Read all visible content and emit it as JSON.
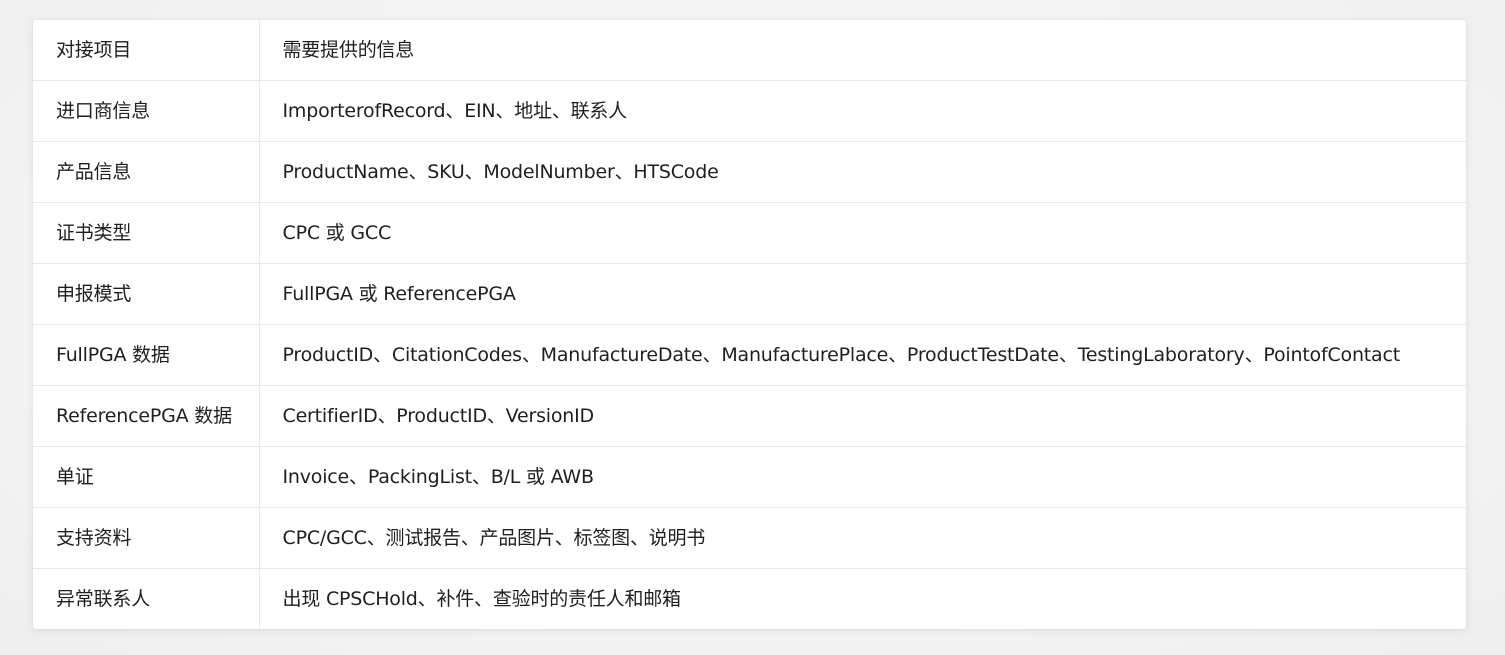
{
  "table": {
    "header": {
      "key": "对接项目",
      "value": "需要提供的信息"
    },
    "rows": [
      {
        "key": "进口商信息",
        "value": "ImporterofRecord、EIN、地址、联系人"
      },
      {
        "key": "产品信息",
        "value": "ProductName、SKU、ModelNumber、HTSCode"
      },
      {
        "key": "证书类型",
        "value": "CPC 或 GCC"
      },
      {
        "key": "申报模式",
        "value": "FullPGA 或 ReferencePGA"
      },
      {
        "key": "FullPGA 数据",
        "value": "ProductID、CitationCodes、ManufactureDate、ManufacturePlace、ProductTestDate、TestingLaboratory、PointofContact"
      },
      {
        "key": "ReferencePGA 数据",
        "value": "CertifierID、ProductID、VersionID"
      },
      {
        "key": "单证",
        "value": "Invoice、PackingList、B/L 或 AWB"
      },
      {
        "key": "支持资料",
        "value": "CPC/GCC、测试报告、产品图片、标签图、说明书"
      },
      {
        "key": "异常联系人",
        "value": "出现 CPSCHold、补件、查验时的责任人和邮箱"
      }
    ]
  }
}
